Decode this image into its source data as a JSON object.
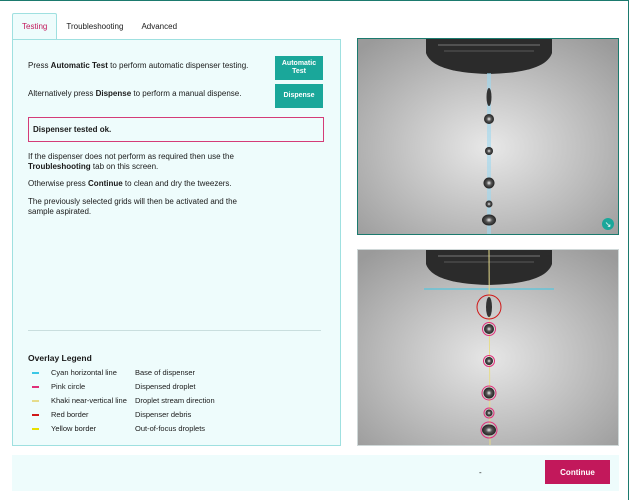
{
  "tabs": [
    {
      "label": "Testing",
      "active": true
    },
    {
      "label": "Troubleshooting",
      "active": false
    },
    {
      "label": "Advanced",
      "active": false
    }
  ],
  "testing": {
    "auto_line": {
      "pre": "Press ",
      "bold": "Automatic Test",
      "post": " to perform automatic dispenser testing."
    },
    "manual_line": {
      "pre": "Alternatively press ",
      "bold": "Dispense",
      "post": " to perform a manual dispense."
    },
    "auto_button": "Automatic Test",
    "dispense_button": "Dispense",
    "status": "Dispenser tested ok.",
    "para1": {
      "pre": "If the dispenser does not perform as required then use the ",
      "bold": "Troubleshooting",
      "post": " tab on this screen."
    },
    "para2": {
      "pre": "Otherwise press ",
      "bold": "Continue",
      "post": "  to clean and dry the tweezers."
    },
    "para3": "The previously selected grids will then be activated and the sample aspirated."
  },
  "legend": {
    "title": "Overlay Legend",
    "items": [
      {
        "label": "Cyan horizontal line",
        "desc": "Base of dispenser",
        "color": "#3cc8e6"
      },
      {
        "label": "Pink circle",
        "desc": "Dispensed droplet",
        "color": "#e0307a"
      },
      {
        "label": "Khaki near-vertical line",
        "desc": "Droplet stream direction",
        "color": "#e6dc8c"
      },
      {
        "label": "Red border",
        "desc": "Dispenser debris",
        "color": "#d01818"
      },
      {
        "label": "Yellow border",
        "desc": "Out-of-focus droplets",
        "color": "#e8e000"
      }
    ]
  },
  "footer": {
    "status": "-",
    "continue_button": "Continue"
  },
  "colors": {
    "accent_teal": "#1aa79a",
    "accent_pink": "#c2185b",
    "panel_bg": "#eefcfc"
  },
  "icons": {
    "expand": "expand-arrow-icon"
  }
}
